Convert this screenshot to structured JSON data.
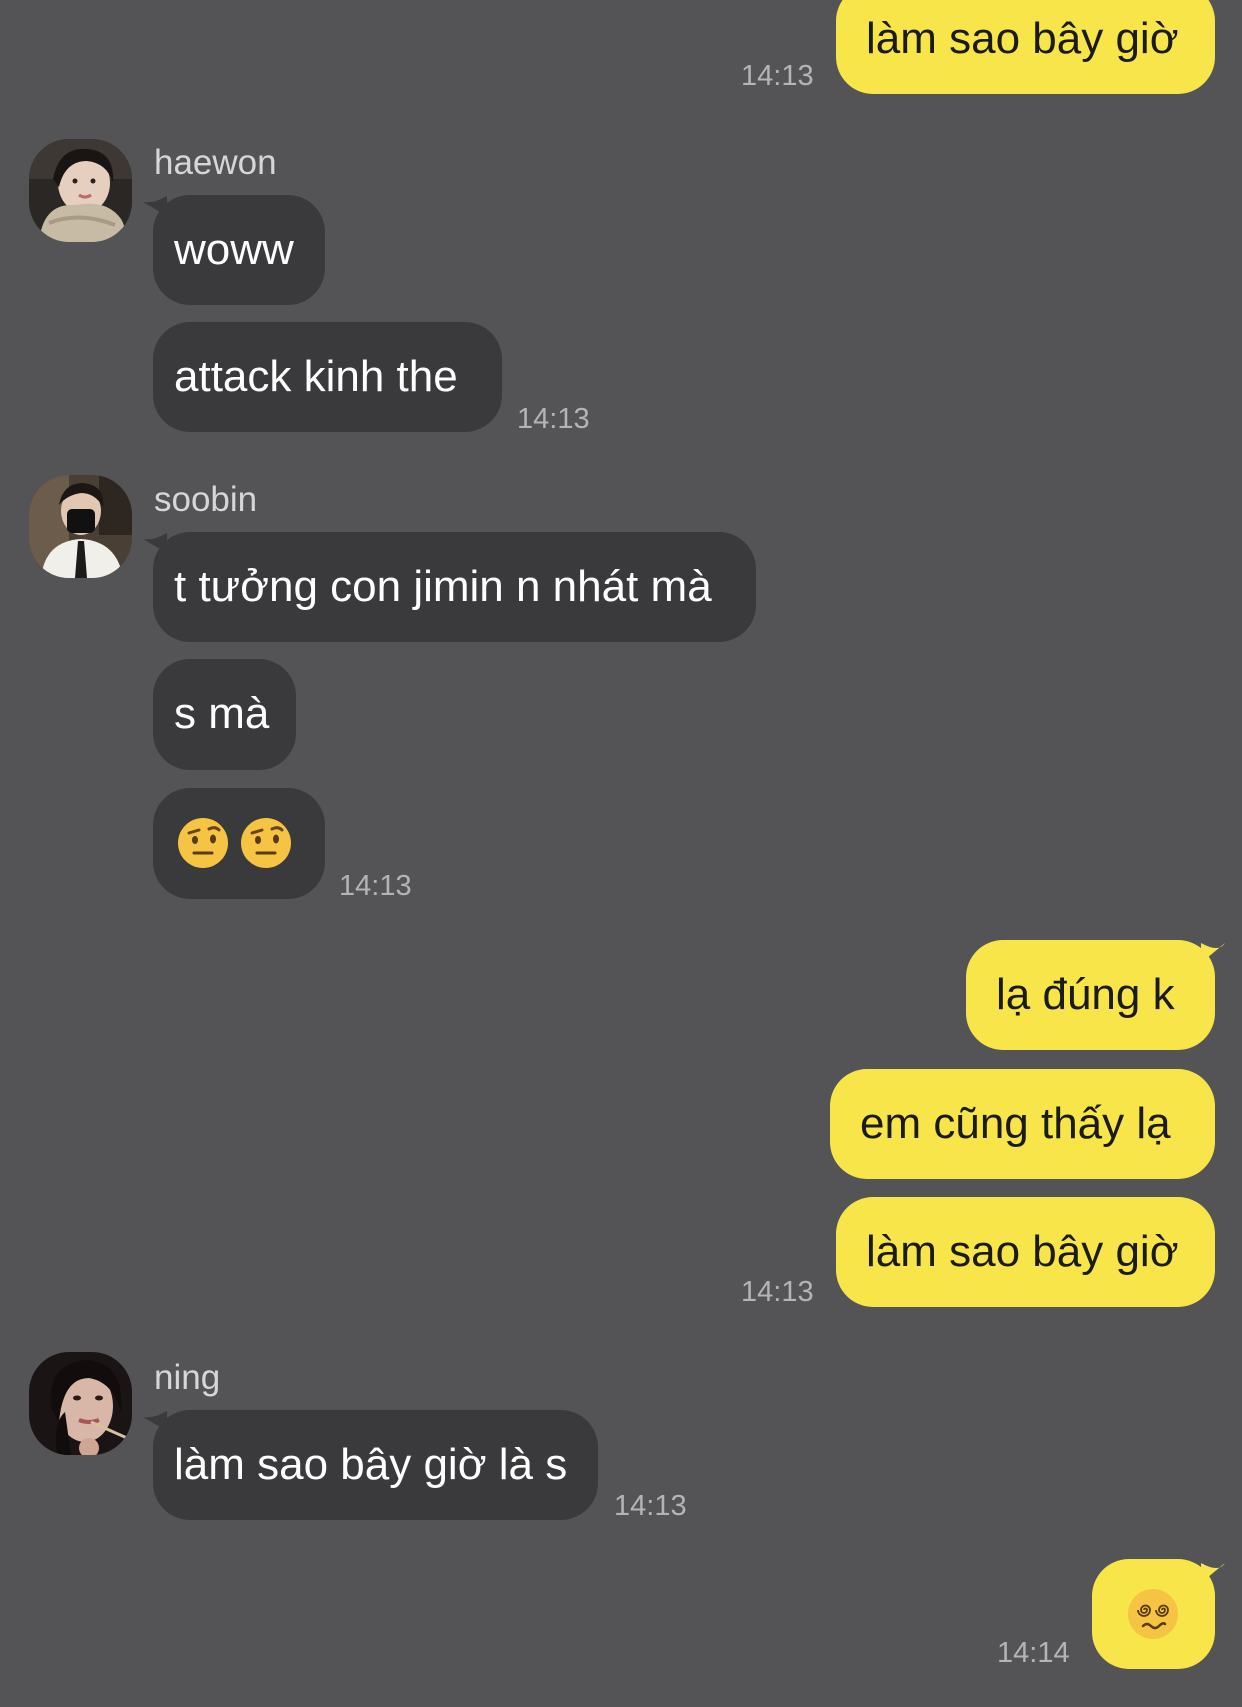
{
  "colors": {
    "background": "#545356",
    "incoming_bubble": "#3a393c",
    "outgoing_bubble": "#f7e549",
    "timestamp": "#b4b3b6",
    "sender_name": "#d6d5d8"
  },
  "messages": {
    "out_top": {
      "text": "làm sao bây giờ",
      "time": "14:13"
    },
    "haewon": {
      "sender": "haewon",
      "avatar_icon": "haewon-avatar",
      "texts": [
        "woww",
        "attack kinh the"
      ],
      "time": "14:13"
    },
    "soobin": {
      "sender": "soobin",
      "avatar_icon": "soobin-avatar",
      "texts": [
        "t tưởng con jimin n nhát mà",
        "s mà"
      ],
      "emoji": "raised-eyebrow-face-icon x2",
      "time": "14:13"
    },
    "out_group": {
      "texts": [
        "lạ đúng k",
        "em cũng thấy lạ",
        "làm sao bây giờ"
      ],
      "time": "14:13"
    },
    "ning": {
      "sender": "ning",
      "avatar_icon": "ning-avatar",
      "texts": [
        "làm sao bây giờ là s"
      ],
      "time": "14:13"
    },
    "out_last": {
      "emoji": "dizzy-face-icon",
      "time": "14:14"
    }
  }
}
